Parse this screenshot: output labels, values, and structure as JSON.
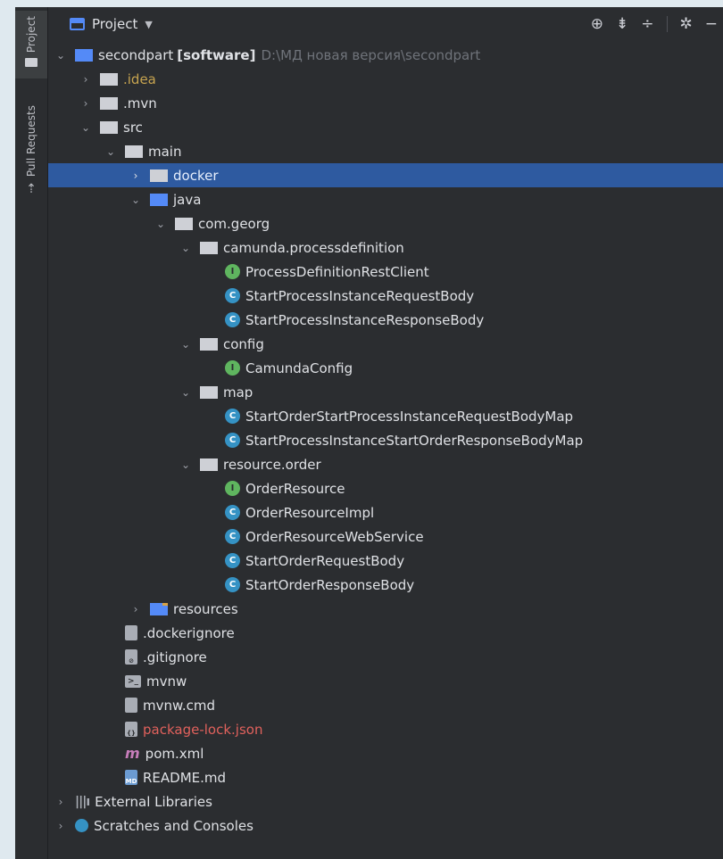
{
  "toolwindow": {
    "left_strip": [
      {
        "label": "Project"
      },
      {
        "label": "Pull Requests"
      }
    ]
  },
  "header": {
    "title": "Project",
    "actions": [
      "locate-icon",
      "expand-all-icon",
      "collapse-all-icon",
      "settings-icon"
    ]
  },
  "tree": {
    "root": {
      "name": "secondpart",
      "module": "[software]",
      "path": "D:\\МД новая версия\\secondpart"
    },
    "idea": ".idea",
    "mvn": ".mvn",
    "src": "src",
    "main": "main",
    "docker": "docker",
    "java": "java",
    "com_georg": "com.georg",
    "camunda": "camunda.processdefinition",
    "camunda_items": [
      {
        "name": "ProcessDefinitionRestClient",
        "kind": "I"
      },
      {
        "name": "StartProcessInstanceRequestBody",
        "kind": "C"
      },
      {
        "name": "StartProcessInstanceResponseBody",
        "kind": "C"
      }
    ],
    "config": "config",
    "config_items": [
      {
        "name": "CamundaConfig",
        "kind": "I"
      }
    ],
    "map": "map",
    "map_items": [
      {
        "name": "StartOrderStartProcessInstanceRequestBodyMap",
        "kind": "C"
      },
      {
        "name": "StartProcessInstanceStartOrderResponseBodyMap",
        "kind": "C"
      }
    ],
    "resource_order": "resource.order",
    "resource_items": [
      {
        "name": "OrderResource",
        "kind": "I"
      },
      {
        "name": "OrderResourceImpl",
        "kind": "C"
      },
      {
        "name": "OrderResourceWebService",
        "kind": "C"
      },
      {
        "name": "StartOrderRequestBody",
        "kind": "C"
      },
      {
        "name": "StartOrderResponseBody",
        "kind": "C"
      }
    ],
    "resources": "resources",
    "files": {
      "dockerignore": ".dockerignore",
      "gitignore": ".gitignore",
      "mvnw": "mvnw",
      "mvnw_cmd": "mvnw.cmd",
      "package_lock": "package-lock.json",
      "pom": "pom.xml",
      "readme": "README.md"
    },
    "external_libraries": "External Libraries",
    "scratches": "Scratches and Consoles"
  },
  "colors": {
    "selection": "#2e5aa0",
    "background": "#2b2d30",
    "excluded_folder": "#c7a450",
    "unversioned_file": "#e0615c"
  }
}
